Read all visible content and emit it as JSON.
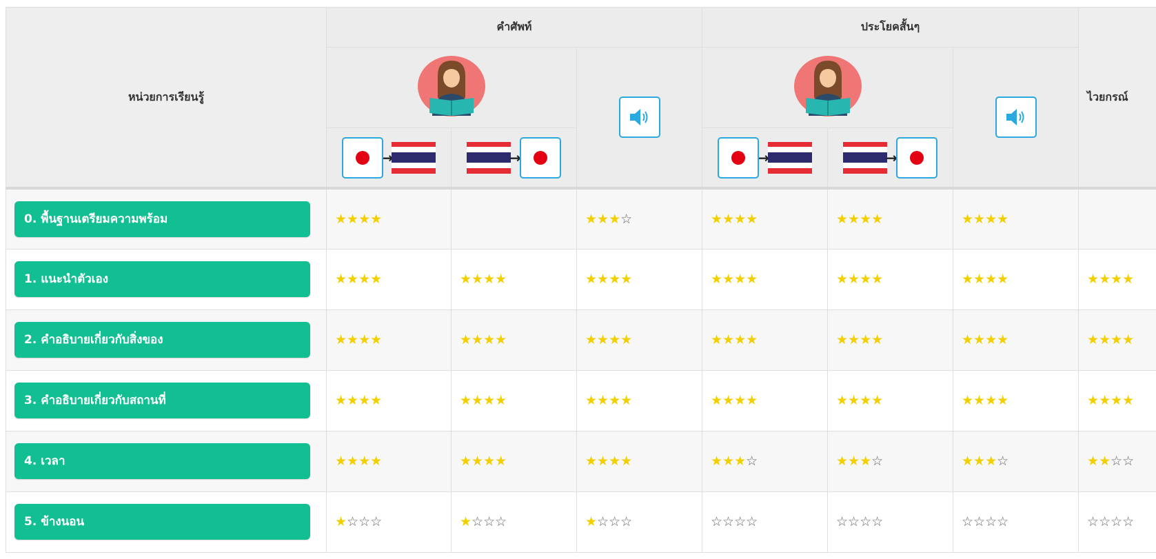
{
  "header": {
    "unit_col": "หน่วยการเรียนรู้",
    "vocab_group": "คำศัพท์",
    "sentence_group": "ประโยคสั้นๆ",
    "grammar_col": "ไวยกรณ์"
  },
  "icons": {
    "teacher": "teacher-reading-icon",
    "sound": "speaker-icon",
    "jp_to_th": "japan-to-thailand-flag-icon",
    "th_to_jp": "thailand-to-japan-flag-icon"
  },
  "colors": {
    "unit_button": "#12bf93",
    "star_filled": "#f2cf00",
    "star_empty": "#666666",
    "icon_border": "#2aa8e0",
    "teacher_bg": "#f07575"
  },
  "rows": [
    {
      "label": "0. พื้นฐานเตรียมความพร้อม",
      "ratings": [
        4,
        null,
        3,
        4,
        4,
        4,
        null
      ]
    },
    {
      "label": "1. แนะนำตัวเอง",
      "ratings": [
        4,
        4,
        4,
        4,
        4,
        4,
        4
      ]
    },
    {
      "label": "2. คำอธิบายเกี่ยวกับสิ่งของ",
      "ratings": [
        4,
        4,
        4,
        4,
        4,
        4,
        4
      ]
    },
    {
      "label": "3. คำอธิบายเกี่ยวกับสถานที่",
      "ratings": [
        4,
        4,
        4,
        4,
        4,
        4,
        4
      ]
    },
    {
      "label": "4. เวลา",
      "ratings": [
        4,
        4,
        4,
        3,
        3,
        3,
        2
      ]
    },
    {
      "label": "5. ข้างนอน",
      "ratings": [
        1,
        1,
        1,
        0,
        0,
        0,
        0
      ]
    }
  ]
}
